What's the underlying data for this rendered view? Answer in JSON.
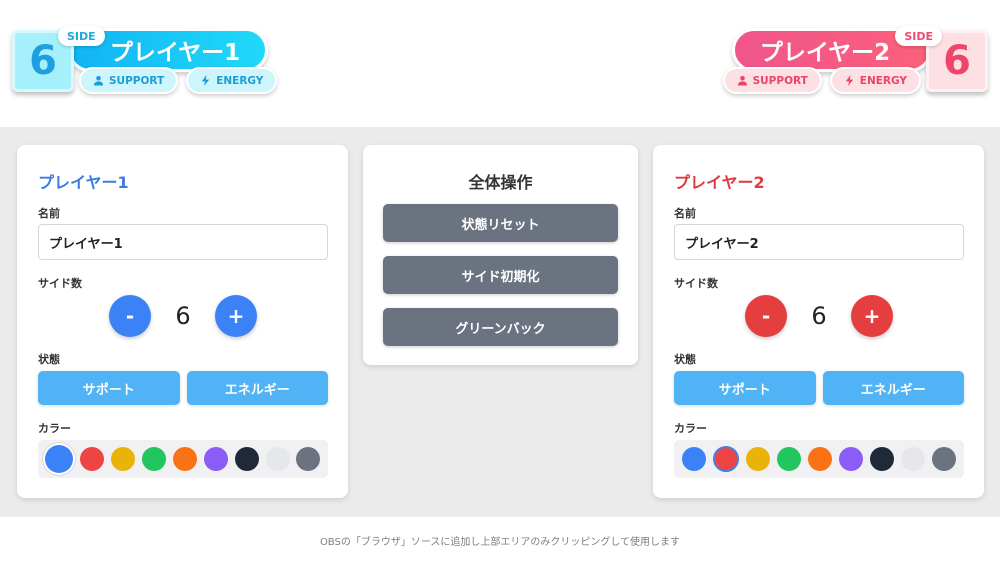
{
  "overlay": {
    "side_tag": "SIDE",
    "player1": {
      "side_count": "6",
      "name": "プレイヤー1",
      "chips": [
        {
          "icon": "person-icon",
          "label": "SUPPORT"
        },
        {
          "icon": "lightning-icon",
          "label": "ENERGY"
        }
      ]
    },
    "player2": {
      "side_count": "6",
      "name": "プレイヤー2",
      "chips": [
        {
          "icon": "person-icon",
          "label": "SUPPORT"
        },
        {
          "icon": "lightning-icon",
          "label": "ENERGY"
        }
      ]
    }
  },
  "panel_player1": {
    "title": "プレイヤー1",
    "name_label": "名前",
    "name_value": "プレイヤー1",
    "side_label": "サイド数",
    "minus": "-",
    "plus": "+",
    "side_value": "6",
    "status_label": "状態",
    "status_buttons": [
      "サポート",
      "エネルギー"
    ],
    "color_label": "カラー",
    "selected_color": "#3b82f6"
  },
  "panel_center": {
    "title": "全体操作",
    "buttons": [
      "状態リセット",
      "サイド初期化",
      "グリーンバック"
    ]
  },
  "panel_player2": {
    "title": "プレイヤー2",
    "name_label": "名前",
    "name_value": "プレイヤー2",
    "side_label": "サイド数",
    "minus": "-",
    "plus": "+",
    "side_value": "6",
    "status_label": "状態",
    "status_buttons": [
      "サポート",
      "エネルギー"
    ],
    "color_label": "カラー",
    "selected_color": "#ef4444"
  },
  "palette": [
    "#3b82f6",
    "#ef4444",
    "#eab308",
    "#22c55e",
    "#f97316",
    "#8b5cf6",
    "#1f2937",
    "#e5e7eb",
    "#6b7280"
  ],
  "footer": "OBSの「ブラウザ」ソースに追加し上部エリアのみクリッピングして使用します"
}
